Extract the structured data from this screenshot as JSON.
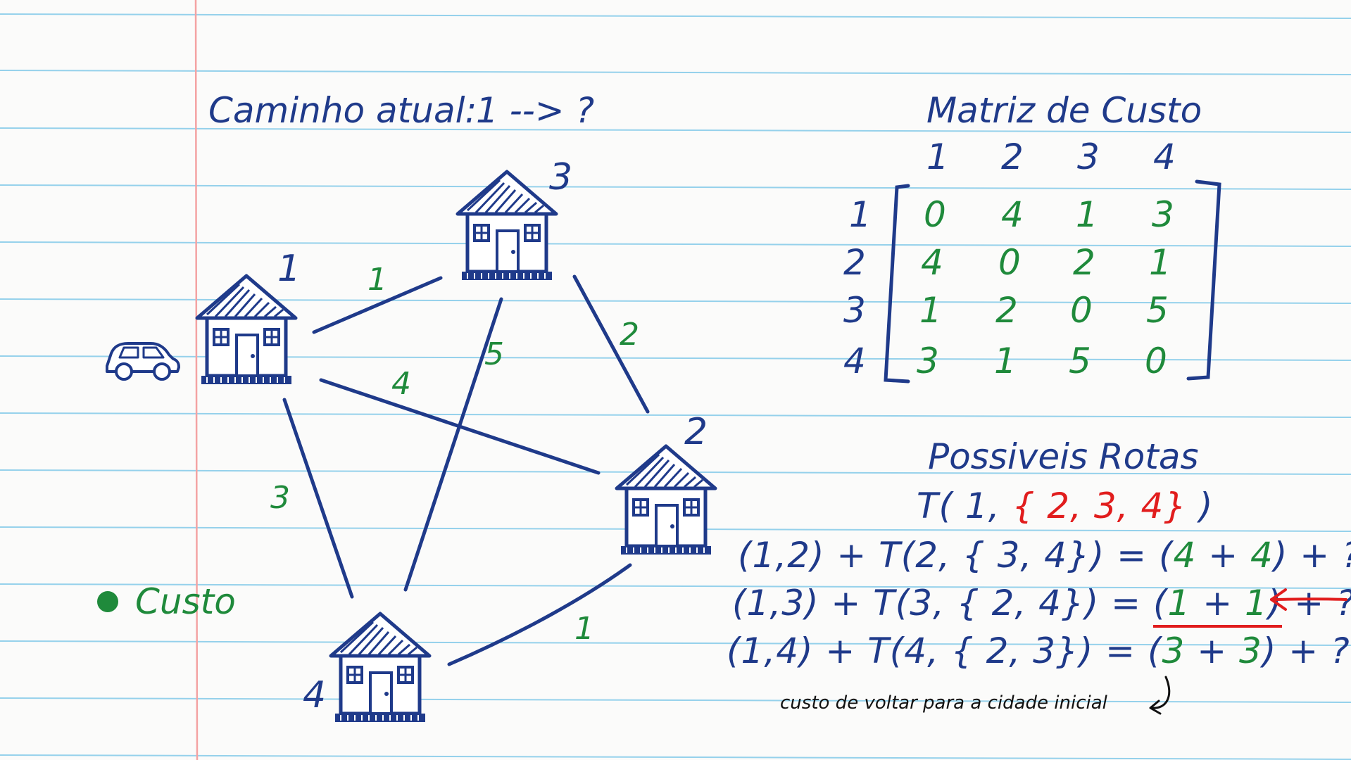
{
  "header": {
    "label": "Caminho atual:",
    "path": "1 --> ?"
  },
  "graph": {
    "nodes": [
      {
        "id": "1"
      },
      {
        "id": "2"
      },
      {
        "id": "3"
      },
      {
        "id": "4"
      }
    ],
    "edges": [
      {
        "from": "1",
        "to": "3",
        "cost": "1"
      },
      {
        "from": "3",
        "to": "2",
        "cost": "2"
      },
      {
        "from": "3",
        "to": "4",
        "cost": "5"
      },
      {
        "from": "1",
        "to": "2",
        "cost": "4"
      },
      {
        "from": "1",
        "to": "4",
        "cost": "3"
      },
      {
        "from": "4",
        "to": "2",
        "cost": "1"
      }
    ]
  },
  "legend": {
    "label": "Custo",
    "color": "#1f8a3b"
  },
  "matrix": {
    "title": "Matriz de Custo",
    "col_headers": [
      "1",
      "2",
      "3",
      "4"
    ],
    "row_headers": [
      "1",
      "2",
      "3",
      "4"
    ],
    "rows": [
      [
        "0",
        "4",
        "1",
        "3"
      ],
      [
        "4",
        "0",
        "2",
        "1"
      ],
      [
        "1",
        "2",
        "0",
        "5"
      ],
      [
        "3",
        "1",
        "5",
        "0"
      ]
    ]
  },
  "routes": {
    "title": "Possiveis Rotas",
    "main": {
      "prefix": "T( 1,",
      "set": "{ 2, 3, 4}",
      "suffix": ")"
    },
    "lines": [
      {
        "pair": "(1,2) + T(2, { 3, 4}) =",
        "open": "(",
        "a": "4",
        "plus": "+",
        "b": "4",
        "close": ")",
        "tail": "+ ?"
      },
      {
        "pair": "(1,3) + T(3, { 2, 4}) =",
        "open": "(",
        "a": "1",
        "plus": "+",
        "b": "1",
        "close": ")",
        "tail": "+ ?"
      },
      {
        "pair": "(1,4) + T(4, { 2, 3}) =",
        "open": "(",
        "a": "3",
        "plus": "+",
        "b": "3",
        "close": ")",
        "tail": "+ ?"
      }
    ],
    "note": "custo de voltar para a cidade inicial"
  },
  "colors": {
    "ink": "#1f3a8a",
    "cost": "#1f8a3b",
    "highlight": "#e11d1d",
    "rule": "#7cc7e8",
    "margin": "#f4a3a3"
  }
}
